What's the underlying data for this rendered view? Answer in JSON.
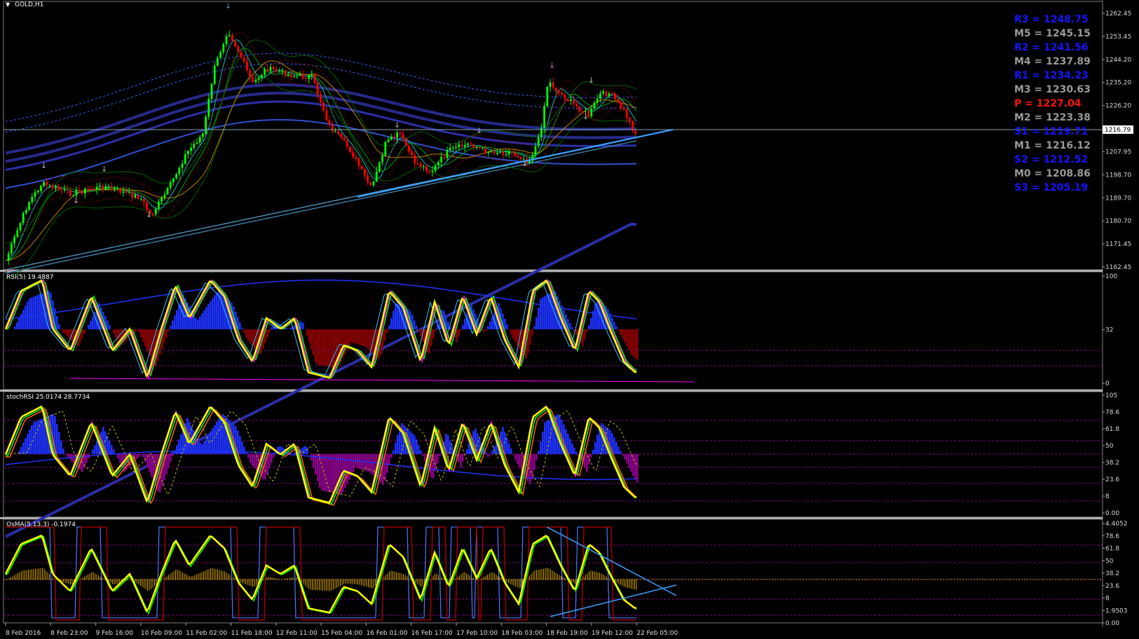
{
  "window": {
    "title": "GOLD,H1"
  },
  "main_panel": {
    "y_ticks": [
      "1262.45",
      "1253.45",
      "1244.20",
      "1235.20",
      "1226.20",
      "1216.79",
      "1207.95",
      "1198.70",
      "1189.70",
      "1180.70",
      "1171.45",
      "1162.45"
    ],
    "current_price": "1216.79"
  },
  "pivots": [
    {
      "label": "R3 = 1248.75",
      "color": "#1414ff"
    },
    {
      "label": "M5 = 1245.15",
      "color": "#9a9a9a"
    },
    {
      "label": "R2 = 1241.56",
      "color": "#1414ff"
    },
    {
      "label": "M4 = 1237.89",
      "color": "#9a9a9a"
    },
    {
      "label": "R1 = 1234.23",
      "color": "#1414ff"
    },
    {
      "label": "M3 = 1230.63",
      "color": "#9a9a9a"
    },
    {
      "label": "P  = 1227.04",
      "color": "#ff1010"
    },
    {
      "label": "M2 = 1223.38",
      "color": "#9a9a9a"
    },
    {
      "label": "S1 = 1219.71",
      "color": "#1414ff"
    },
    {
      "label": "M1 = 1216.12",
      "color": "#9a9a9a"
    },
    {
      "label": "S2 = 1212.52",
      "color": "#1414ff"
    },
    {
      "label": "M0 = 1208.86",
      "color": "#9a9a9a"
    },
    {
      "label": "S3 = 1205.19",
      "color": "#1414ff"
    }
  ],
  "rsi_panel": {
    "title": "RSI(5) 19.4887",
    "y_ticks": [
      "100",
      "32",
      "0"
    ]
  },
  "stoch_panel": {
    "title": "stochRSI 25.0174 28.7734",
    "y_ticks": [
      "105",
      "78.6",
      "61.8",
      "50",
      "38.2",
      "23.6",
      "8",
      "0.00"
    ]
  },
  "osma_panel": {
    "title": "OsMA(5,13,3) -0.1974",
    "y_ticks": [
      "4.4052",
      "78.6",
      "61.8",
      "50",
      "38.2",
      "23.6",
      "8",
      "1.9503",
      "0.00"
    ]
  },
  "x_axis": [
    "8 Feb 2016",
    "8 Feb 23:00",
    "9 Feb 16:00",
    "10 Feb 09:00",
    "11 Feb 02:00",
    "11 Feb 18:00",
    "12 Feb 11:00",
    "15 Feb 04:00",
    "16 Feb 01:00",
    "16 Feb 17:00",
    "17 Feb 10:00",
    "18 Feb 03:00",
    "18 Feb 19:00",
    "19 Feb 12:00",
    "22 Feb 05:00"
  ],
  "colors": {
    "bull": "#00ff00",
    "bear": "#ff0000",
    "rsi_line": "#ffff00",
    "hist_pos": "#1e32ff",
    "hist_neg": "#8b0000",
    "hist_neg2": "#8b008b",
    "trend": "#3aa0ff"
  }
}
